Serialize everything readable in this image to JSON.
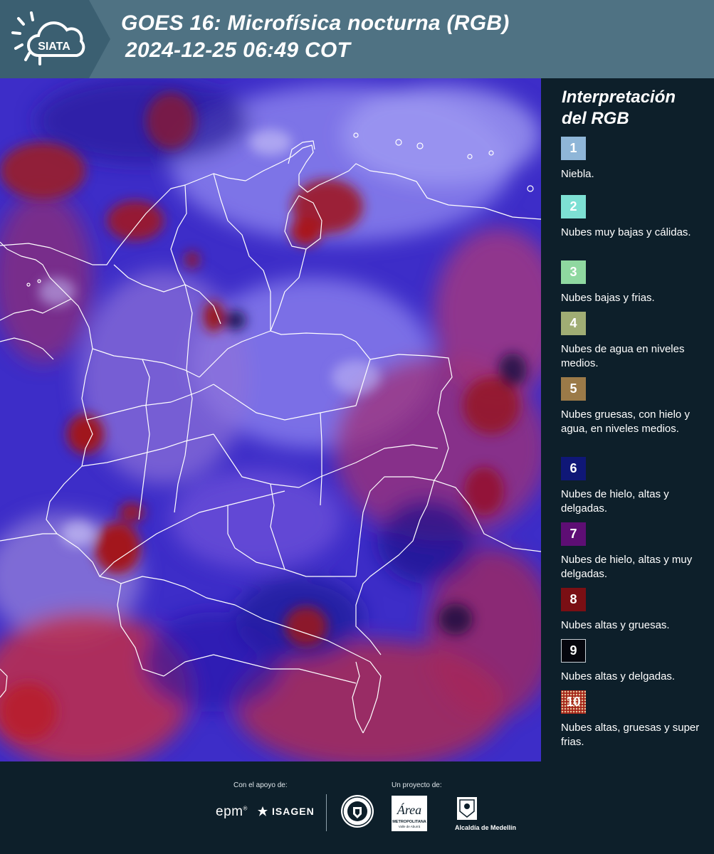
{
  "header": {
    "logo_text": "SIATA",
    "title": "GOES 16: Microfísica nocturna (RGB)",
    "datetime": "2024-12-25 06:49 COT"
  },
  "legend": {
    "title_line1": "Interpretación",
    "title_line2": "del RGB",
    "items": [
      {
        "num": "1",
        "label": "Niebla.",
        "color": "#8fb6d8"
      },
      {
        "num": "2",
        "label": "Nubes muy bajas y cálidas.",
        "color": "#7de0d4"
      },
      {
        "num": "3",
        "label": "Nubes bajas y frias.",
        "color": "#8fd8a0"
      },
      {
        "num": "4",
        "label": "Nubes de agua en niveles medios.",
        "color": "#a0ad74"
      },
      {
        "num": "5",
        "label": "Nubes gruesas, con hielo y agua, en niveles medios.",
        "color": "#9b7a48"
      },
      {
        "num": "6",
        "label": "Nubes de hielo, altas y delgadas.",
        "color": "#0f1777"
      },
      {
        "num": "7",
        "label": "Nubes de hielo, altas y muy delgadas.",
        "color": "#5e0e74"
      },
      {
        "num": "8",
        "label": "Nubes altas y gruesas.",
        "color": "#7a0f14"
      },
      {
        "num": "9",
        "label": "Nubes altas y delgadas.",
        "color": "#05060d"
      },
      {
        "num": "10",
        "label": "Nubes altas, gruesas y super frias.",
        "color": "#a42318"
      }
    ]
  },
  "footer": {
    "support_label": "Con el apoyo de:",
    "project_label": "Un proyecto de:",
    "sponsor1": "epm",
    "sponsor2": "ISAGEN",
    "partner_area_text": "Área",
    "partner_area_sub": "METROPOLITANA",
    "partner_area_sub2": "Valle de Aburrá",
    "partner_alcaldia": "Alcaldía de Medellín"
  }
}
